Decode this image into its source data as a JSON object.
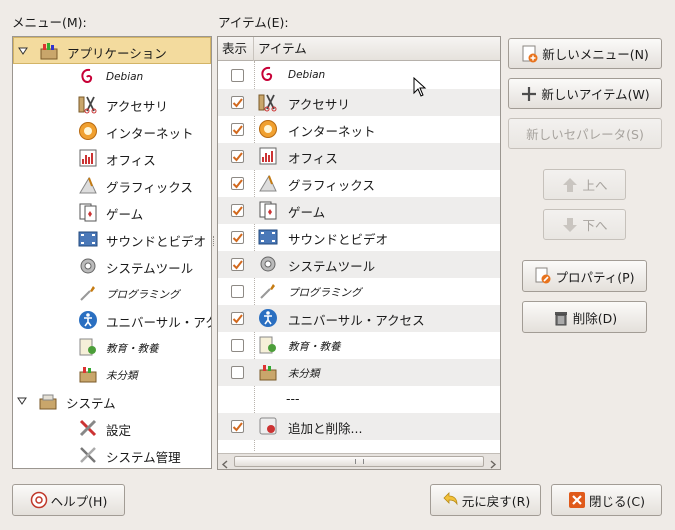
{
  "labels": {
    "menu_label": "メニュー(M):",
    "items_label": "アイテム(E):"
  },
  "tree": {
    "rows": [
      {
        "label": "アプリケーション",
        "icon": "applications-icon",
        "level": 0,
        "expanded": true,
        "selected": true
      },
      {
        "label": "Debian",
        "icon": "debian-icon",
        "level": 1,
        "italic": true
      },
      {
        "label": "アクセサリ",
        "icon": "accessories-icon",
        "level": 1
      },
      {
        "label": "インターネット",
        "icon": "internet-icon",
        "level": 1
      },
      {
        "label": "オフィス",
        "icon": "office-icon",
        "level": 1
      },
      {
        "label": "グラフィックス",
        "icon": "graphics-icon",
        "level": 1
      },
      {
        "label": "ゲーム",
        "icon": "games-icon",
        "level": 1
      },
      {
        "label": "サウンドとビデオ",
        "icon": "sound-video-icon",
        "level": 1
      },
      {
        "label": "システムツール",
        "icon": "system-tools-icon",
        "level": 1
      },
      {
        "label": "プログラミング",
        "icon": "programming-icon",
        "level": 1,
        "italic": true
      },
      {
        "label": "ユニバーサル・アクセス",
        "icon": "universal-access-icon",
        "level": 1
      },
      {
        "label": "教育・教養",
        "icon": "education-icon",
        "level": 1,
        "italic": true
      },
      {
        "label": "未分類",
        "icon": "other-icon",
        "level": 1,
        "italic": true
      },
      {
        "label": "システム",
        "icon": "system-icon",
        "level": 0,
        "expanded": true
      },
      {
        "label": "設定",
        "icon": "preferences-icon",
        "level": 1
      },
      {
        "label": "システム管理",
        "icon": "administration-icon",
        "level": 1
      }
    ]
  },
  "items_list": {
    "col_show": "表示",
    "col_item": "アイテム",
    "rows": [
      {
        "label": "Debian",
        "icon": "debian-icon",
        "checked": false,
        "italic": true
      },
      {
        "label": "アクセサリ",
        "icon": "accessories-icon",
        "checked": true
      },
      {
        "label": "インターネット",
        "icon": "internet-icon",
        "checked": true
      },
      {
        "label": "オフィス",
        "icon": "office-icon",
        "checked": true
      },
      {
        "label": "グラフィックス",
        "icon": "graphics-icon",
        "checked": true
      },
      {
        "label": "ゲーム",
        "icon": "games-icon",
        "checked": true
      },
      {
        "label": "サウンドとビデオ",
        "icon": "sound-video-icon",
        "checked": true
      },
      {
        "label": "システムツール",
        "icon": "system-tools-icon",
        "checked": true
      },
      {
        "label": "プログラミング",
        "icon": "programming-icon",
        "checked": false,
        "italic": true
      },
      {
        "label": "ユニバーサル・アクセス",
        "icon": "universal-access-icon",
        "checked": true
      },
      {
        "label": "教育・教養",
        "icon": "education-icon",
        "checked": false,
        "italic": true
      },
      {
        "label": "未分類",
        "icon": "other-icon",
        "checked": false,
        "italic": true
      },
      {
        "label": "---",
        "icon": "",
        "checked": null,
        "separator": true
      },
      {
        "label": "追加と削除...",
        "icon": "add-remove-icon",
        "checked": true
      }
    ]
  },
  "buttons": {
    "new_menu": "新しいメニュー(N)",
    "new_item": "新しいアイテム(W)",
    "new_separator": "新しいセパレータ(S)",
    "move_up": "上へ",
    "move_down": "下へ",
    "properties": "プロパティ(P)",
    "delete": "削除(D)",
    "help": "ヘルプ(H)",
    "revert": "元に戻す(R)",
    "close": "閉じる(C)"
  },
  "colors": {
    "selection": "#f3db9e",
    "window_bg": "#efebe7",
    "close_button_icon": "#e05a1a"
  }
}
